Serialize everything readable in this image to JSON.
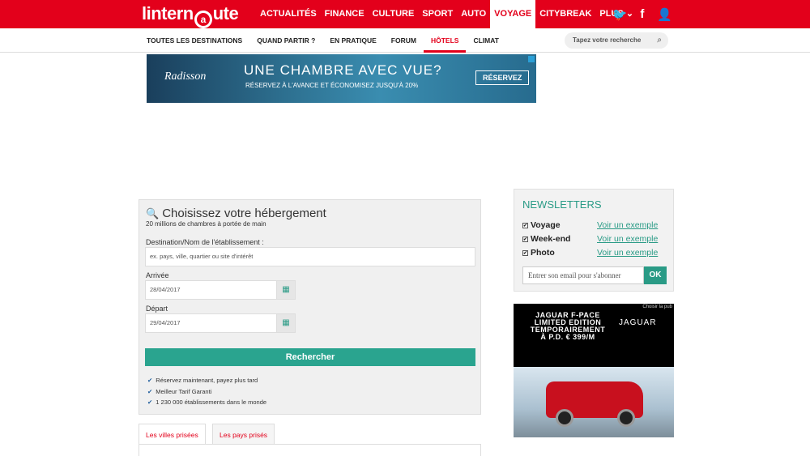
{
  "brand": {
    "prefix": "lintern",
    "at": "a",
    "suffix": "ute"
  },
  "topnav": [
    {
      "label": "ACTUALITÉS"
    },
    {
      "label": "FINANCE"
    },
    {
      "label": "CULTURE"
    },
    {
      "label": "SPORT"
    },
    {
      "label": "AUTO"
    },
    {
      "label": "VOYAGE",
      "active": true
    },
    {
      "label": "CITYBREAK"
    },
    {
      "label": "PLUS"
    }
  ],
  "topicons": {
    "plus_chevron": "⌄",
    "twitter": "🐦",
    "facebook": "f",
    "user": "👤"
  },
  "subnav": [
    {
      "label": "TOUTES LES DESTINATIONS"
    },
    {
      "label": "QUAND PARTIR ?"
    },
    {
      "label": "EN PRATIQUE"
    },
    {
      "label": "FORUM"
    },
    {
      "label": "HÔTELS",
      "active": true
    },
    {
      "label": "CLIMAT"
    }
  ],
  "search": {
    "placeholder": "Tapez votre recherche"
  },
  "banner": {
    "brand": "Radisson",
    "headline": "UNE CHAMBRE AVEC VUE?",
    "sub": "RÉSERVEZ À L'AVANCE ET ÉCONOMISEZ JUSQU'À 20%",
    "button": "RÉSERVEZ"
  },
  "booking": {
    "title": "Choisissez votre hébergement",
    "subtitle": "20 millions de chambres à portée de main",
    "dest_label": "Destination/Nom de l'établissement :",
    "dest_placeholder": "ex. pays, ville, quartier ou site d'intérêt",
    "arrive_label": "Arrivée",
    "arrive_value": "28/04/2017",
    "depart_label": "Départ",
    "depart_value": "29/04/2017",
    "search_button": "Rechercher",
    "benefits": [
      "Réservez maintenant, payez plus tard",
      "Meilleur Tarif Garanti",
      "1 230 000 établissements dans le monde"
    ]
  },
  "tabs": [
    {
      "label": "Les villes prisées",
      "active": true
    },
    {
      "label": "Les pays prisés"
    }
  ],
  "newsletter": {
    "title": "NEWSLETTERS",
    "items": [
      {
        "label": "Voyage",
        "link": "Voir un exemple"
      },
      {
        "label": "Week-end",
        "link": "Voir un exemple"
      },
      {
        "label": "Photo",
        "link": "Voir un exemple"
      }
    ],
    "email_placeholder": "Entrer son email pour s'abonner",
    "ok_label": "OK"
  },
  "ad2": {
    "tag": "Choisir la pub",
    "line1": "JAGUAR F-PACE",
    "line2": "LIMITED EDITION",
    "line3": "TEMPORAIREMENT",
    "line4": "À P.D. € 399/M",
    "logo": "JAGUAR"
  }
}
